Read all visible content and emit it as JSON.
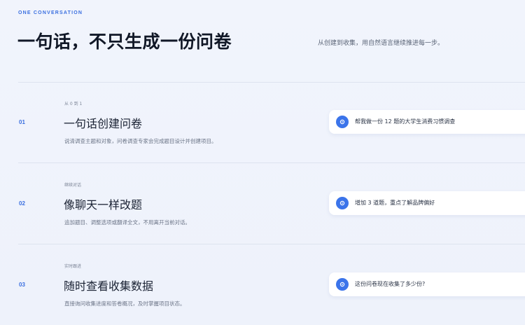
{
  "header": {
    "eyebrow": "ONE CONVERSATION",
    "title": "一句话，不只生成一份问卷",
    "subtitle": "从创建到收集，用自然语言继续推进每一步。"
  },
  "steps": [
    {
      "number": "01",
      "tag": "从 0 到 1",
      "title": "一句话创建问卷",
      "description": "说清调查主题和对象，问卷调查专家会完成题目设计并创建项目。",
      "chat": {
        "avatar_icon": "ai-assistant-icon",
        "message": "帮我做一份 12 题的大学生消费习惯调查"
      }
    },
    {
      "number": "02",
      "tag": "继续对话",
      "title": "像聊天一样改题",
      "description": "追加题目、调整选项或翻译全文，不用离开当前对话。",
      "chat": {
        "avatar_icon": "ai-assistant-icon",
        "message": "增加 3 道题，重点了解品牌偏好"
      }
    },
    {
      "number": "03",
      "tag": "实时跟进",
      "title": "随时查看收集数据",
      "description": "直接询问收集进度和答卷概况，及时掌握项目状态。",
      "chat": {
        "avatar_icon": "ai-assistant-icon",
        "message": "这份问卷现在收集了多少份?"
      }
    }
  ],
  "colors": {
    "accent": "#3a6fe0",
    "avatar": "#3b74ea",
    "background": "#eef2fb"
  }
}
